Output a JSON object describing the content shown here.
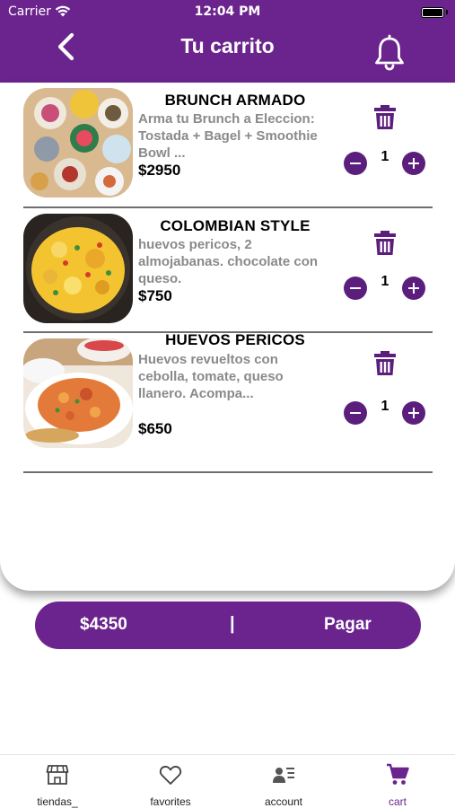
{
  "status_bar": {
    "carrier": "Carrier",
    "time": "12:04 PM"
  },
  "header": {
    "title": "Tu carrito"
  },
  "items": [
    {
      "name": "BRUNCH ARMADO",
      "description": "Arma tu Brunch a Eleccion: Tostada + Bagel + Smoothie Bowl ...",
      "price": "$2950",
      "quantity": "1"
    },
    {
      "name": "COLOMBIAN STYLE",
      "description": "huevos pericos, 2 almojabanas. chocolate con queso.",
      "price": "$750",
      "quantity": "1"
    },
    {
      "name": "HUEVOS PERICOS",
      "description": "Huevos revueltos con cebolla, tomate, queso llanero. Acompa...",
      "price": "$650",
      "quantity": "1"
    }
  ],
  "checkout": {
    "total": "$4350",
    "separator": "|",
    "pay_label": "Pagar"
  },
  "tabs": [
    {
      "label": "tiendas_",
      "icon": "store-icon",
      "active": false
    },
    {
      "label": "favorites",
      "icon": "heart-icon",
      "active": false
    },
    {
      "label": "account",
      "icon": "account-icon",
      "active": false
    },
    {
      "label": "cart",
      "icon": "cart-icon",
      "active": true
    }
  ],
  "colors": {
    "brand": "#6b248e",
    "button": "#5c1e7d",
    "muted_text": "#8a8a8a"
  }
}
